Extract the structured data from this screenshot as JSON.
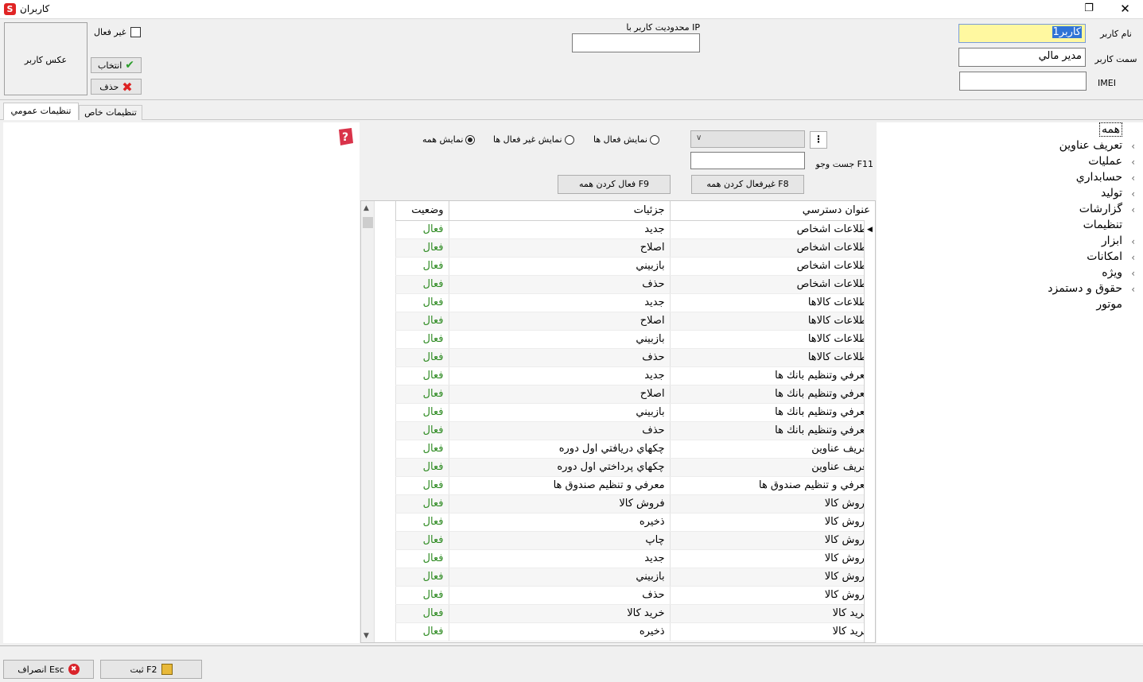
{
  "window": {
    "title": "كاربران"
  },
  "user_form": {
    "username_label": "نام كاربر",
    "username_value": "كاربر1",
    "position_label": "سمت كاربر",
    "position_value": "مدير مالي",
    "imei_label": "IMEI",
    "ip_limit_label": "محدوديت كاربر با IP",
    "inactive_label": "غير فعال",
    "photo_label": "عكس كاربر",
    "select_button": "انتخاب",
    "delete_button": "حذف"
  },
  "tabs": [
    {
      "label": "تنظيمات عمومي",
      "active": true
    },
    {
      "label": "تنظيمات خاص",
      "active": false
    }
  ],
  "filters": {
    "show_all": "نمايش همه",
    "show_inactive": "نمايش غير فعال ها",
    "show_active": "نمايش فعال ها",
    "selected": "show_all",
    "search_label": "جست وجو F11",
    "deactivate_all_button": "غيرفعال كردن همه F8",
    "activate_all_button": "فعال كردن همه F9"
  },
  "grid": {
    "columns": [
      "عنوان دسترسي",
      "جزئيات",
      "وضعيت"
    ],
    "rows": [
      [
        "اطلاعات اشخاص",
        "جديد",
        "فعال"
      ],
      [
        "اطلاعات اشخاص",
        "اصلاح",
        "فعال"
      ],
      [
        "اطلاعات اشخاص",
        "بازبيني",
        "فعال"
      ],
      [
        "اطلاعات اشخاص",
        "حذف",
        "فعال"
      ],
      [
        "اطلاعات كالاها",
        "جديد",
        "فعال"
      ],
      [
        "اطلاعات كالاها",
        "اصلاح",
        "فعال"
      ],
      [
        "اطلاعات كالاها",
        "بازبيني",
        "فعال"
      ],
      [
        "اطلاعات كالاها",
        "حذف",
        "فعال"
      ],
      [
        "معرفي وتنظيم بانك ها",
        "جديد",
        "فعال"
      ],
      [
        "معرفي وتنظيم بانك ها",
        "اصلاح",
        "فعال"
      ],
      [
        "معرفي وتنظيم بانك ها",
        "بازبيني",
        "فعال"
      ],
      [
        "معرفي وتنظيم بانك ها",
        "حذف",
        "فعال"
      ],
      [
        "تعريف عناوين",
        "چكهاي دريافتي اول دوره",
        "فعال"
      ],
      [
        "تعريف عناوين",
        "چكهاي پرداختي اول دوره",
        "فعال"
      ],
      [
        "معرفي و تنظيم صندوق ها",
        "معرفي و تنظيم صندوق ها",
        "فعال"
      ],
      [
        "فروش كالا",
        "فروش كالا",
        "فعال"
      ],
      [
        "فروش كالا",
        "ذخيره",
        "فعال"
      ],
      [
        "فروش كالا",
        "چاپ",
        "فعال"
      ],
      [
        "فروش كالا",
        "جديد",
        "فعال"
      ],
      [
        "فروش كالا",
        "بازبيني",
        "فعال"
      ],
      [
        "فروش كالا",
        "حذف",
        "فعال"
      ],
      [
        "خريد كالا",
        "خريد كالا",
        "فعال"
      ],
      [
        "خريد كالا",
        "ذخيره",
        "فعال"
      ]
    ]
  },
  "tree": [
    {
      "label": "همه",
      "expandable": false,
      "selected": true
    },
    {
      "label": "تعريف عناوين",
      "expandable": true
    },
    {
      "label": "عمليات",
      "expandable": true
    },
    {
      "label": "حسابداري",
      "expandable": true
    },
    {
      "label": "توليد",
      "expandable": true
    },
    {
      "label": "گزارشات",
      "expandable": true
    },
    {
      "label": "تنظيمات",
      "expandable": false
    },
    {
      "label": "ابزار",
      "expandable": true
    },
    {
      "label": "امكانات",
      "expandable": true
    },
    {
      "label": "ويژه",
      "expandable": true
    },
    {
      "label": "حقوق و دستمزد",
      "expandable": true
    },
    {
      "label": "موتور",
      "expandable": false
    }
  ],
  "footer": {
    "save_button": "ثبت F2",
    "cancel_button": "انصراف Esc"
  },
  "colors": {
    "status_active": "#2e8b22",
    "username_bg": "#fff8a0",
    "selection": "#3074d6"
  }
}
